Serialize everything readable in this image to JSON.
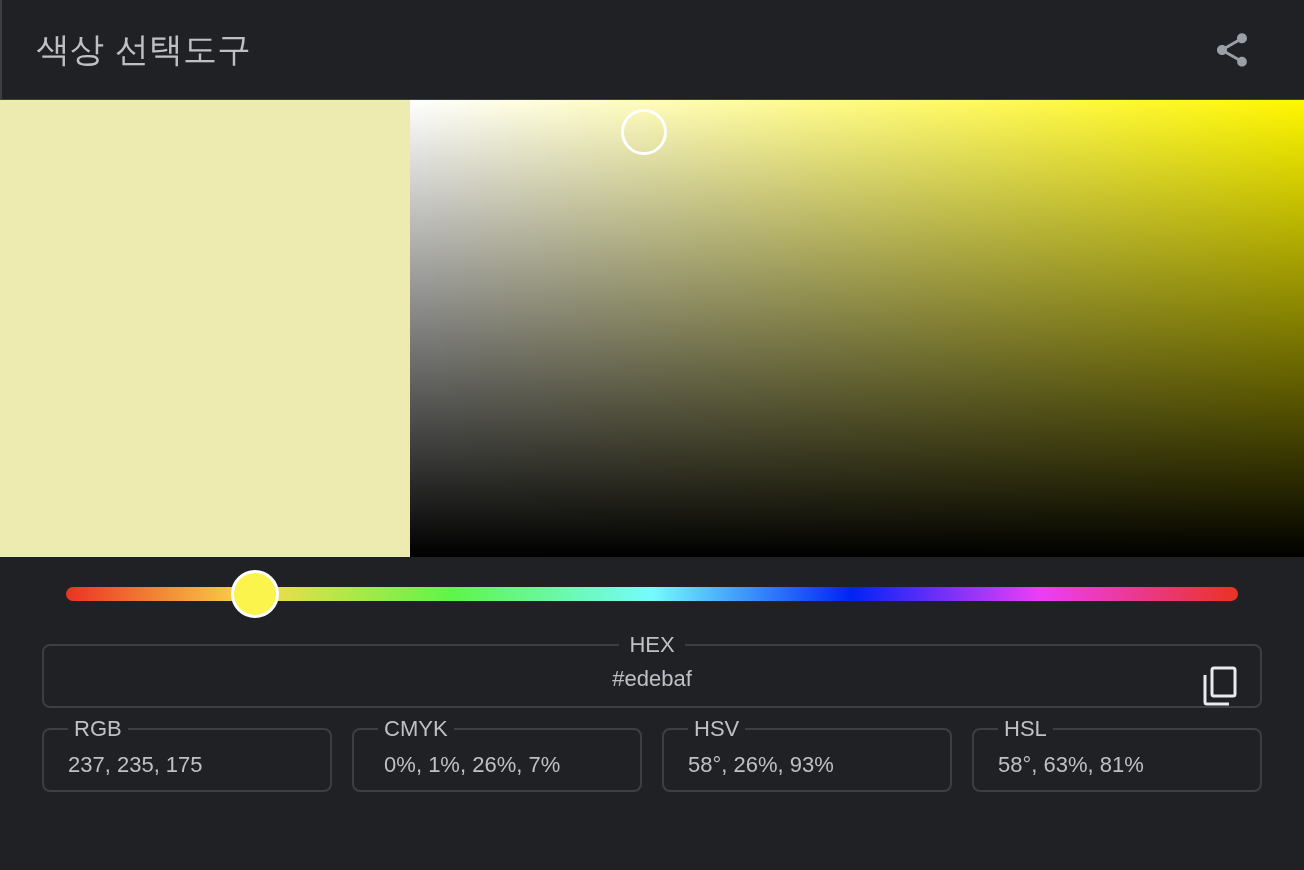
{
  "header": {
    "title": "색상 선택도구"
  },
  "picker": {
    "color": "#edebaf"
  },
  "hue_slider": {
    "level": 0.161
  },
  "hex": {
    "label": "HEX",
    "value": "#edebaf"
  },
  "formats": [
    {
      "label": "RGB",
      "value": "237, 235, 175"
    },
    {
      "label": "CMYK",
      "value": " 0%, 1%, 26%, 7%"
    },
    {
      "label": "HSV",
      "value": "58°, 26%, 93%"
    },
    {
      "label": "HSL",
      "value": "58°, 63%, 81%"
    }
  ]
}
